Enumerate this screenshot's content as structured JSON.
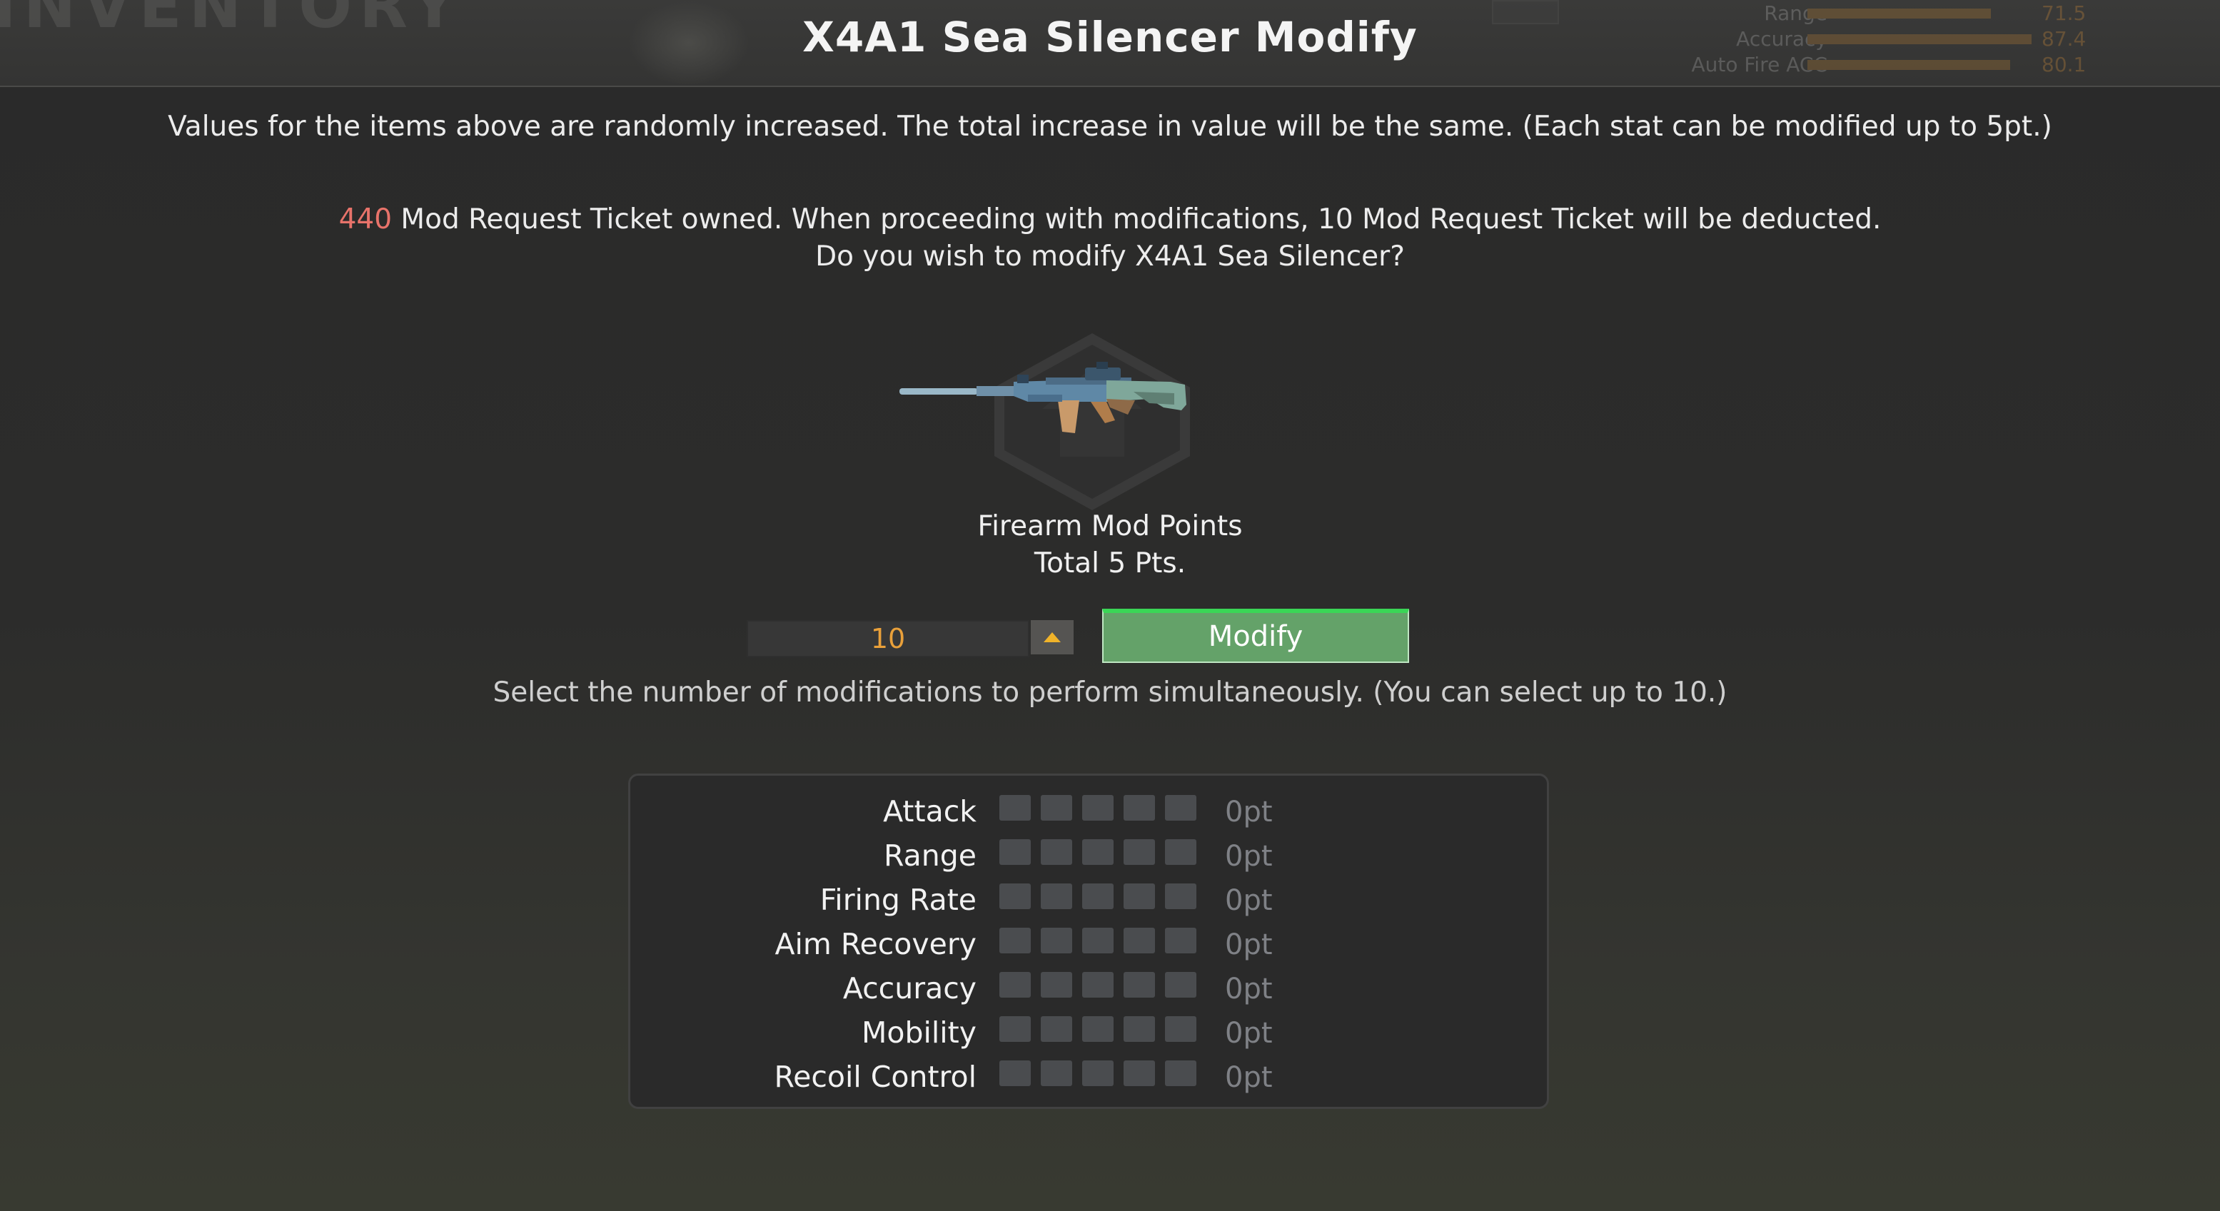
{
  "background": {
    "inventory_text": "INVENTORY",
    "stats": [
      {
        "label": "Range",
        "value": "71.5",
        "fill_fraction": 0.78
      },
      {
        "label": "Accuracy",
        "value": "87.4",
        "fill_fraction": 0.95
      },
      {
        "label": "Auto Fire ACC",
        "value": "80.1",
        "fill_fraction": 0.86
      }
    ]
  },
  "dialog": {
    "title": "X4A1 Sea Silencer Modify",
    "description": "Values for the items above are randomly increased. The total increase in value will be the same. (Each stat can be modified up to 5pt.)",
    "ticket_count": "440",
    "ticket_text": " Mod Request Ticket owned. When proceeding with modifications, 10 Mod Request Ticket will be deducted.",
    "confirm_question": "Do you wish to modify X4A1 Sea Silencer?",
    "mod_points_label": "Firearm Mod Points",
    "mod_points_total": "Total 5 Pts.",
    "stepper_value": "10",
    "modify_button": "Modify",
    "hint": "Select the number of modifications to perform simultaneously. (You can select up to 10.)"
  },
  "stats": [
    {
      "name": "Attack",
      "value": "0pt",
      "filled": 0,
      "max": 5
    },
    {
      "name": "Range",
      "value": "0pt",
      "filled": 0,
      "max": 5
    },
    {
      "name": "Firing Rate",
      "value": "0pt",
      "filled": 0,
      "max": 5
    },
    {
      "name": "Aim Recovery",
      "value": "0pt",
      "filled": 0,
      "max": 5
    },
    {
      "name": "Accuracy",
      "value": "0pt",
      "filled": 0,
      "max": 5
    },
    {
      "name": "Mobility",
      "value": "0pt",
      "filled": 0,
      "max": 5
    },
    {
      "name": "Recoil Control",
      "value": "0pt",
      "filled": 0,
      "max": 5
    }
  ],
  "colors": {
    "ticket_count": "#e8736a",
    "stepper_value": "#e9a03a",
    "modify_button": "#64a269",
    "stat_box_empty": "#4a4c4f",
    "stat_box_filled": "#e9a03a"
  },
  "icons": {
    "weapon": "rifle-image",
    "badge": "hexagon-emblem-icon",
    "stepper_up": "triangle-up-icon"
  }
}
